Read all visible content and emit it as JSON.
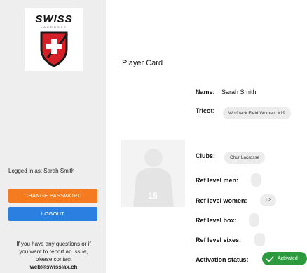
{
  "brand": {
    "logo_text": "SWISS",
    "logo_subtext": "LACROSSE",
    "logo_colors": {
      "red": "#d62027",
      "black": "#1a1a1a"
    }
  },
  "sidebar": {
    "logged_in_label": "Logged in as: Sarah Smith",
    "change_password_label": "CHANGE PASSWORD",
    "logout_label": "LOGOUT",
    "help_text_1": "If you have any questions or if",
    "help_text_2": "you want to report an issue,",
    "help_text_3": "please contact",
    "help_email": "web@swisslax.ch",
    "colors": {
      "orange": "#f47b20",
      "blue": "#2a7fe0"
    }
  },
  "main": {
    "title": "Player Card",
    "name_label": "Name:",
    "name_value": "Sarah Smith",
    "tricot_label": "Tricot:",
    "tricot_value": "Wolfpack Field Women: #19",
    "photo_number": "15",
    "clubs_label": "Clubs:",
    "clubs_value": "Chur Lacrosse",
    "ref_men_label": "Ref level men:",
    "ref_men_value": "",
    "ref_women_label": "Ref level women:",
    "ref_women_value": "L2",
    "ref_box_label": "Ref level box:",
    "ref_box_value": "",
    "ref_sixes_label": "Ref level sixes:",
    "ref_sixes_value": "",
    "activation_label": "Activation status:",
    "activation_value": "Activated",
    "status_color": "#2e9a3e"
  }
}
